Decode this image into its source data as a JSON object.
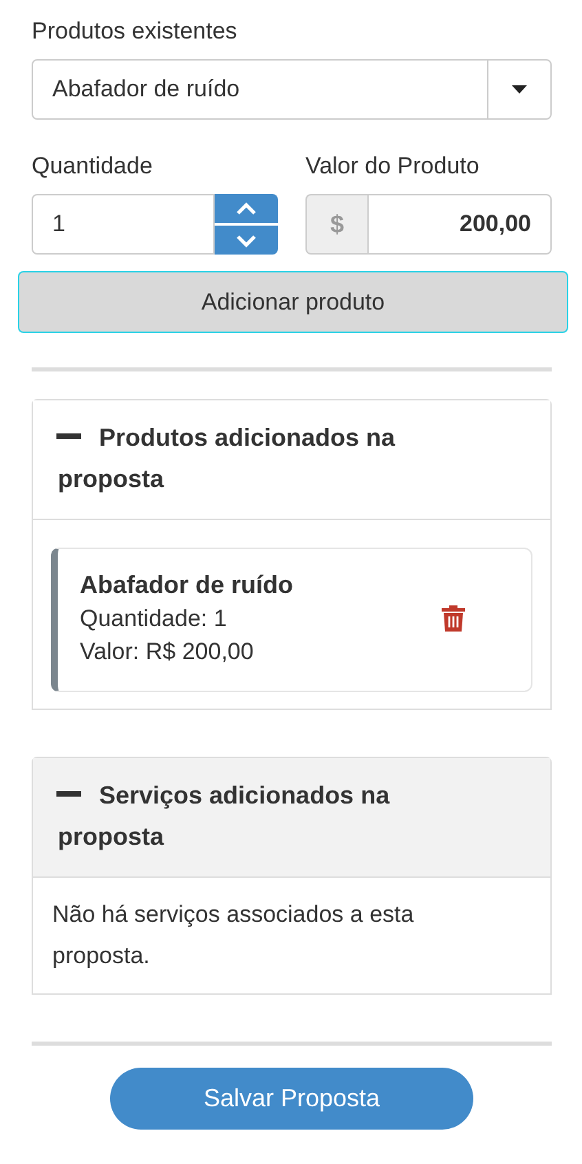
{
  "product_select": {
    "label": "Produtos existentes",
    "value": "Abafador de ruído"
  },
  "quantity": {
    "label": "Quantidade",
    "value": "1"
  },
  "price": {
    "label": "Valor do Produto",
    "prefix": "$",
    "value": "200,00"
  },
  "add_button": "Adicionar produto",
  "panels": [
    {
      "kind": "products",
      "title": "Produtos adicionados na proposta",
      "expanded": true,
      "highlighted": false,
      "items": [
        {
          "name": "Abafador de ruído",
          "quantity": "Quantidade: 1",
          "value": "Valor: R$ 200,00"
        }
      ]
    },
    {
      "kind": "empty",
      "title": "Serviços adicionados na proposta",
      "expanded": true,
      "highlighted": true,
      "message": "Não há serviços associados a esta proposta."
    }
  ],
  "save_button": "Salvar Proposta"
}
